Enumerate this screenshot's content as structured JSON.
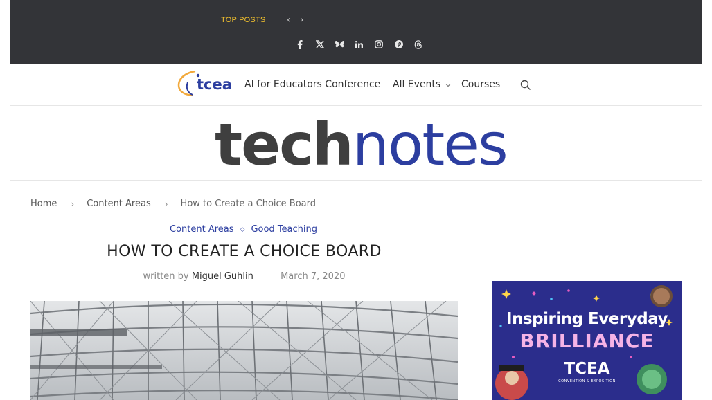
{
  "topbar": {
    "top_posts_label": "TOP POSTS",
    "prev_icon": "‹",
    "next_icon": "›",
    "social": [
      {
        "name": "facebook-icon",
        "glyph": "f"
      },
      {
        "name": "x-twitter-icon",
        "glyph": "𝕏"
      },
      {
        "name": "bluesky-icon",
        "glyph": "🦋"
      },
      {
        "name": "linkedin-icon",
        "glyph": "in"
      },
      {
        "name": "instagram-icon",
        "glyph": "◎"
      },
      {
        "name": "pinterest-icon",
        "glyph": "P"
      },
      {
        "name": "threads-icon",
        "glyph": "@"
      }
    ],
    "colors": {
      "background": "#333438",
      "accent": "#f2c12e"
    }
  },
  "nav": {
    "logo_text": "tcea",
    "links": {
      "ai": "AI for Educators Conference",
      "events": "All Events",
      "courses": "Courses"
    },
    "events_chevron": "›",
    "search_icon": "search-icon"
  },
  "masthead": {
    "brand_part1": "tech",
    "brand_part2": "notes",
    "colors": {
      "part1": "#3f3f3f",
      "part2": "#2c3ea0"
    }
  },
  "breadcrumb": {
    "home": "Home",
    "category": "Content Areas",
    "current": "How to Create a Choice Board",
    "separator": "›"
  },
  "post": {
    "categories": [
      "Content Areas",
      "Good Teaching"
    ],
    "category_separator": "◇",
    "title": "HOW TO CREATE A CHOICE BOARD",
    "written_by": "written by",
    "author": "Miguel Guhlin",
    "date_separator": "I",
    "date": "March 7, 2020"
  },
  "ad": {
    "line1": "Inspiring Everyday",
    "line2": "BRILLIANCE",
    "brand": "TCEA",
    "sub": "CONVENTION & EXPOSITION"
  }
}
